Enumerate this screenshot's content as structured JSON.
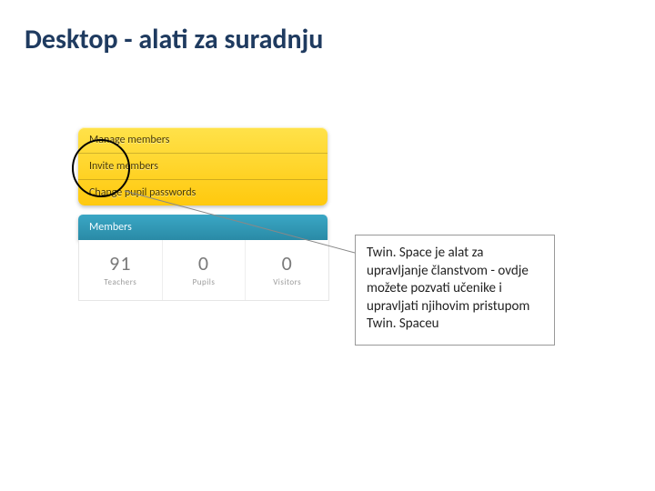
{
  "title": "Desktop - alati za  suradnju",
  "yellow": {
    "rows": [
      "Manage members",
      "Invite members",
      "Change pupil passwords"
    ]
  },
  "members_header": "Members",
  "stats": [
    {
      "num": "91",
      "lbl": "Teachers"
    },
    {
      "num": "0",
      "lbl": "Pupils"
    },
    {
      "num": "0",
      "lbl": "Visitors"
    }
  ],
  "callout_text": "Twin. Space je alat za upravljanje članstvom - ovdje možete pozvati učenike i upravljati njihovim pristupom Twin. Spaceu"
}
